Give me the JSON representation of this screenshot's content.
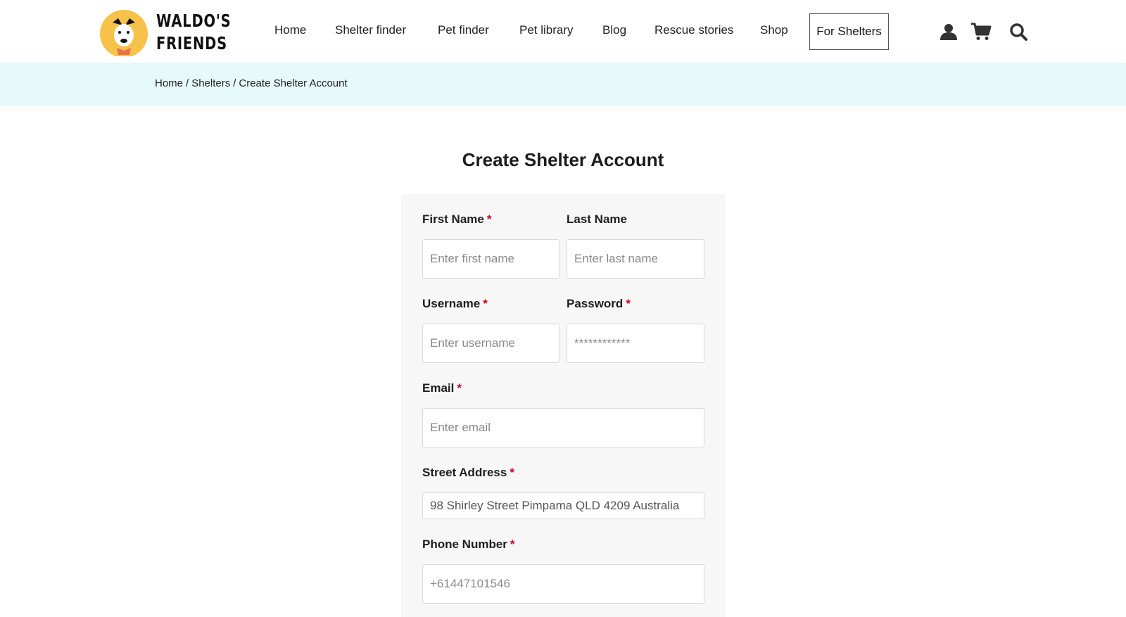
{
  "brand": {
    "logo_line1": "WALDO'S",
    "logo_line2": "FRIENDS",
    "accent_color": "#f7c24a",
    "required_color": "#d0021b"
  },
  "nav": {
    "items": [
      {
        "label": "Home"
      },
      {
        "label": "Shelter finder"
      },
      {
        "label": "Pet finder"
      },
      {
        "label": "Pet library"
      },
      {
        "label": "Blog"
      },
      {
        "label": "Rescue stories"
      },
      {
        "label": "Shop"
      }
    ],
    "cta_label": "For Shelters",
    "icons": [
      "user-icon",
      "cart-icon",
      "search-icon"
    ]
  },
  "breadcrumb": {
    "items": [
      "Home",
      "Shelters",
      "Create Shelter Account"
    ],
    "separator": "/"
  },
  "page": {
    "title": "Create Shelter Account"
  },
  "form": {
    "first_name": {
      "label": "First Name",
      "required": "*",
      "placeholder": "Enter first name",
      "value": ""
    },
    "last_name": {
      "label": "Last Name",
      "placeholder": "Enter last name",
      "value": ""
    },
    "username": {
      "label": "Username",
      "required": "*",
      "placeholder": "Enter username",
      "value": ""
    },
    "password": {
      "label": "Password",
      "required": "*",
      "placeholder": "************",
      "value": ""
    },
    "email": {
      "label": "Email",
      "required": "*",
      "placeholder": "Enter email",
      "value": ""
    },
    "street_address": {
      "label": "Street Address",
      "required": "*",
      "value": "98 Shirley Street Pimpama QLD 4209 Australia"
    },
    "phone_number": {
      "label": "Phone Number",
      "required": "*",
      "placeholder": "+61447101546",
      "value": ""
    }
  }
}
